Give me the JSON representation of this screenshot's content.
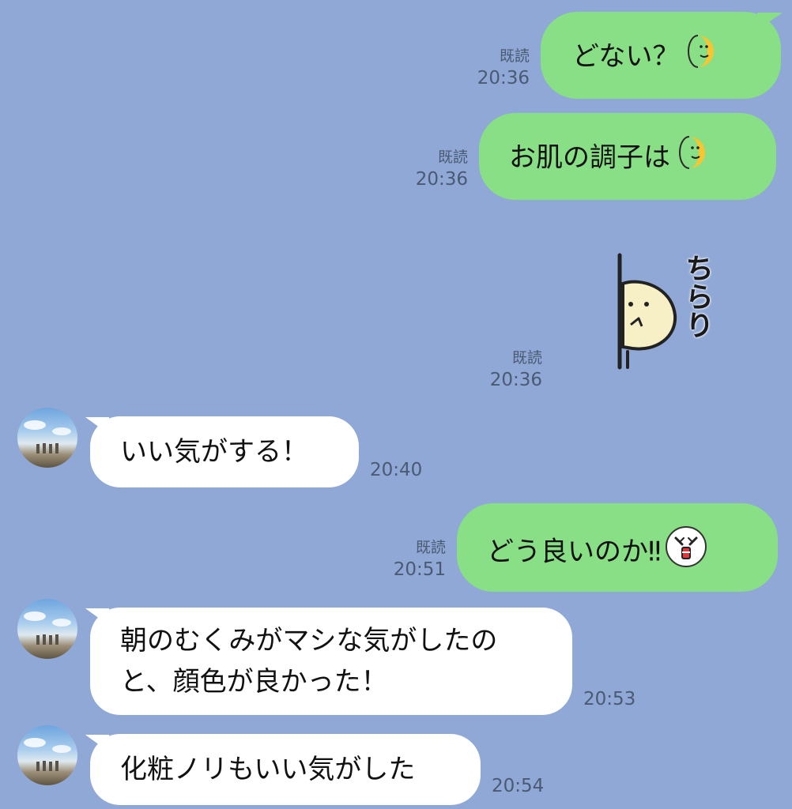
{
  "messages": [
    {
      "id": "m1",
      "side": "out",
      "text": "どない？",
      "emoji": "half-moon-face-icon",
      "read": "既読",
      "time": "20:36"
    },
    {
      "id": "m2",
      "side": "out",
      "text": "お肌の調子は",
      "emoji": "half-moon-face-icon",
      "read": "既読",
      "time": "20:36"
    },
    {
      "id": "m3",
      "side": "out",
      "sticker": "peeking-character-sticker",
      "sticker_text": "ちらり",
      "read": "既読",
      "time": "20:36"
    },
    {
      "id": "m4",
      "side": "in",
      "text": "いい気がする！",
      "time": "20:40"
    },
    {
      "id": "m5",
      "side": "out",
      "text": "どう良いのか",
      "suffix": "‼",
      "emoji": "face-with-pointing-hands-icon",
      "read": "既読",
      "time": "20:51"
    },
    {
      "id": "m6",
      "side": "in",
      "lines": [
        "朝のむくみがマシな気がしたの",
        "と、顔色が良かった！"
      ],
      "time": "20:53"
    },
    {
      "id": "m7",
      "side": "in",
      "text": "化粧ノリもいい気がした",
      "time": "20:54"
    }
  ],
  "colors": {
    "background": "#8fa8d6",
    "outgoing_bubble": "#89df85",
    "incoming_bubble": "#ffffff",
    "meta_text": "#4b5a72"
  }
}
